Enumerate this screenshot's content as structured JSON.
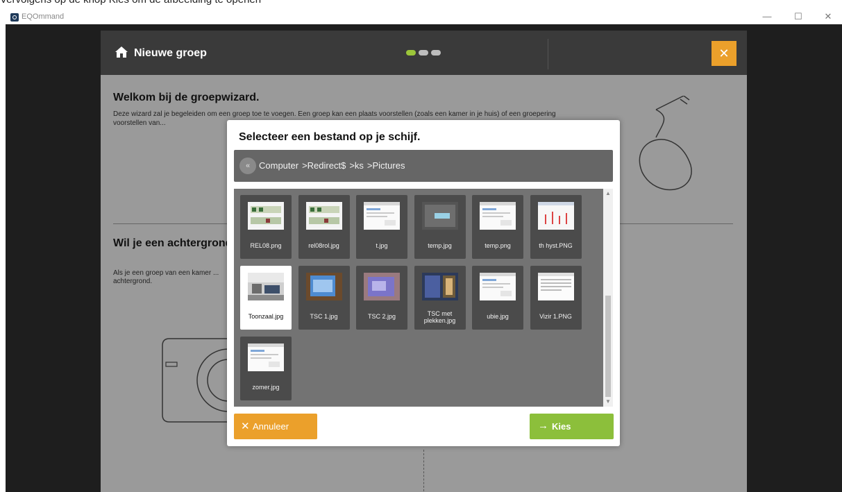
{
  "caption": "Vervolgens op de knop Kies om de afbeelding te openen",
  "window": {
    "title": "EQOmmand",
    "minimize": "—",
    "maximize": "☐",
    "close": "✕"
  },
  "wizard": {
    "title": "Nieuwe groep",
    "close": "✕",
    "steps": 3,
    "active_step": 1,
    "welcome_title": "Welkom bij de groepwizard.",
    "welcome_text": "Deze wizard zal je begeleiden om een groep toe te voegen. Een groep kan een plaats voorstellen (zoals een kamer in je huis) of een groepering voorstellen van...",
    "background_title": "Wil je een achtergrond",
    "background_text": "Als je een groep van een kamer ... achtergrond."
  },
  "dialog": {
    "title": "Selecteer een bestand op je schijf.",
    "back": "«",
    "breadcrumb": [
      "Computer",
      "Redirect$",
      "ks",
      "Pictures"
    ],
    "breadcrumb_sep": ">",
    "files": [
      {
        "name": "REL08.png",
        "thumb": "wiring"
      },
      {
        "name": "rel08rol.jpg",
        "thumb": "wiring"
      },
      {
        "name": "t.jpg",
        "thumb": "window"
      },
      {
        "name": "temp.jpg",
        "thumb": "device-dark"
      },
      {
        "name": "temp.png",
        "thumb": "window"
      },
      {
        "name": "th hyst.PNG",
        "thumb": "graph"
      },
      {
        "name": "Toonzaal.jpg",
        "thumb": "room",
        "selected": true
      },
      {
        "name": "TSC 1.jpg",
        "thumb": "screen-blue"
      },
      {
        "name": "TSC 2.jpg",
        "thumb": "screen-purple"
      },
      {
        "name": "TSC met plekken.jpg",
        "thumb": "screen-dark"
      },
      {
        "name": "ubie.jpg",
        "thumb": "window"
      },
      {
        "name": "Vizir 1.PNG",
        "thumb": "window-light"
      },
      {
        "name": "zomer.jpg",
        "thumb": "window"
      }
    ],
    "cancel": "Annuleer",
    "cancel_icon": "✕",
    "ok": "Kies",
    "ok_icon": "→"
  },
  "colors": {
    "accent_orange": "#eba02b",
    "accent_green": "#8cbf3b",
    "step_active": "#9cc63a"
  }
}
